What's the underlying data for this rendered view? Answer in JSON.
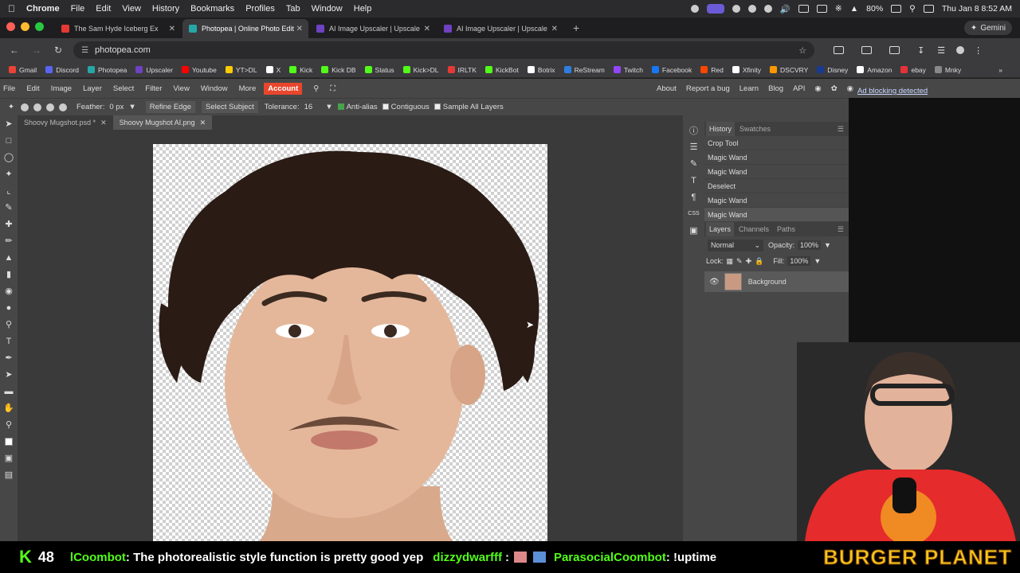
{
  "macbar": {
    "app": "Chrome",
    "menus": [
      "File",
      "Edit",
      "View",
      "History",
      "Bookmarks",
      "Profiles",
      "Tab",
      "Window",
      "Help"
    ],
    "battery": "80%",
    "datetime": "Thu Jan 8  8:52 AM"
  },
  "tabs": [
    {
      "title": "The Sam Hyde Iceberg Ex",
      "active": false,
      "color": "#e53935"
    },
    {
      "title": "Photopea | Online Photo Edit",
      "active": true,
      "color": "#25a7a7"
    },
    {
      "title": "AI Image Upscaler | Upscale",
      "active": false,
      "color": "#6f42c1"
    },
    {
      "title": "AI Image Upscaler | Upscale",
      "active": false,
      "color": "#6f42c1"
    }
  ],
  "gemini_label": "Gemini",
  "address": {
    "url": "photopea.com"
  },
  "bookmarks": [
    {
      "label": "Gmail",
      "color": "#ea4335"
    },
    {
      "label": "Discord",
      "color": "#5865f2"
    },
    {
      "label": "Photopea",
      "color": "#25a7a7"
    },
    {
      "label": "Upscaler",
      "color": "#6f42c1"
    },
    {
      "label": "Youtube",
      "color": "#ff0000"
    },
    {
      "label": "YT>DL",
      "color": "#ffcc00"
    },
    {
      "label": "X",
      "color": "#ffffff"
    },
    {
      "label": "Kick",
      "color": "#53fc18"
    },
    {
      "label": "Kick DB",
      "color": "#53fc18"
    },
    {
      "label": "Status",
      "color": "#53fc18"
    },
    {
      "label": "Kick>DL",
      "color": "#53fc18"
    },
    {
      "label": "IRLTK",
      "color": "#e53935"
    },
    {
      "label": "KickBot",
      "color": "#53fc18"
    },
    {
      "label": "Botrix",
      "color": "#ffffff"
    },
    {
      "label": "ReStream",
      "color": "#2f7de1"
    },
    {
      "label": "Twitch",
      "color": "#9146ff"
    },
    {
      "label": "Facebook",
      "color": "#1877f2"
    },
    {
      "label": "Red",
      "color": "#ff4500"
    },
    {
      "label": "Xfinity",
      "color": "#ffffff"
    },
    {
      "label": "DSCVRY",
      "color": "#ff9800"
    },
    {
      "label": "Disney",
      "color": "#1a3a8f"
    },
    {
      "label": "Amazon",
      "color": "#ffffff"
    },
    {
      "label": "ebay",
      "color": "#e53238"
    },
    {
      "label": "Mnky",
      "color": "#888888"
    }
  ],
  "photopea": {
    "menu": [
      "File",
      "Edit",
      "Image",
      "Layer",
      "Select",
      "Filter",
      "View",
      "Window",
      "More"
    ],
    "account": "Account",
    "right_links": [
      "About",
      "Report a bug",
      "Learn",
      "Blog",
      "API"
    ],
    "adblock": "Ad blocking detected",
    "options": {
      "feather_label": "Feather:",
      "feather_value": "0 px",
      "refine_edge": "Refine Edge",
      "select_subject": "Select Subject",
      "tolerance_label": "Tolerance:",
      "tolerance_value": "16",
      "anti_alias": "Anti-alias",
      "contiguous": "Contiguous",
      "sample_all": "Sample All Layers"
    },
    "doc_tabs": [
      "Shoovy Mugshot.psd *",
      "Shoovy Mugshot AI.png"
    ],
    "history_tabs": [
      "History",
      "Swatches"
    ],
    "history": [
      "Crop Tool",
      "Magic Wand",
      "Magic Wand",
      "Deselect",
      "Magic Wand",
      "Magic Wand"
    ],
    "layers_tabs": [
      "Layers",
      "Channels",
      "Paths"
    ],
    "blend_mode": "Normal",
    "opacity_label": "Opacity:",
    "opacity_value": "100%",
    "lock_label": "Lock:",
    "fill_label": "Fill:",
    "fill_value": "100%",
    "layer_name": "Background"
  },
  "ticker": {
    "count": "48",
    "user1": "lCoombot",
    "msg1": ": The photorealistic style function is pretty good yep",
    "user2": "dizzydwarfff",
    "msg2": ":",
    "user3": "ParasocialCoombot",
    "msg3": ": !uptime",
    "brand": "BURGER PLANET"
  }
}
